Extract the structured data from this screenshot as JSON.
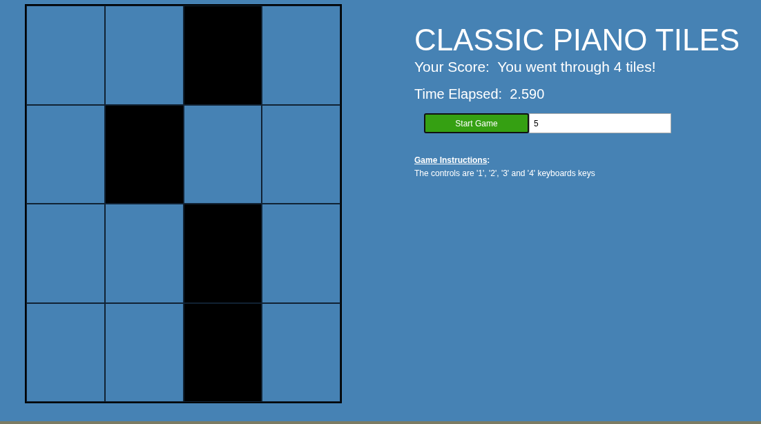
{
  "board": {
    "rows": [
      {
        "tiles": [
          {
            "black": false
          },
          {
            "black": false
          },
          {
            "black": true
          },
          {
            "black": false
          }
        ]
      },
      {
        "tiles": [
          {
            "black": false
          },
          {
            "black": true
          },
          {
            "black": false
          },
          {
            "black": false
          }
        ]
      },
      {
        "tiles": [
          {
            "black": false
          },
          {
            "black": false
          },
          {
            "black": true
          },
          {
            "black": false
          }
        ]
      },
      {
        "tiles": [
          {
            "black": false
          },
          {
            "black": false
          },
          {
            "black": true
          },
          {
            "black": false
          }
        ]
      }
    ]
  },
  "title": "CLASSIC PIANO TILES",
  "score": "Your Score:  You went through 4 tiles!",
  "time": "Time Elapsed:  2.590",
  "start_button": "Start Game",
  "tiles_input": {
    "value": "5"
  },
  "instructions": {
    "heading": "Game Instructions",
    "heading_suffix": ":",
    "text": "The controls are '1', '2', '3' and '4' keyboards keys"
  }
}
